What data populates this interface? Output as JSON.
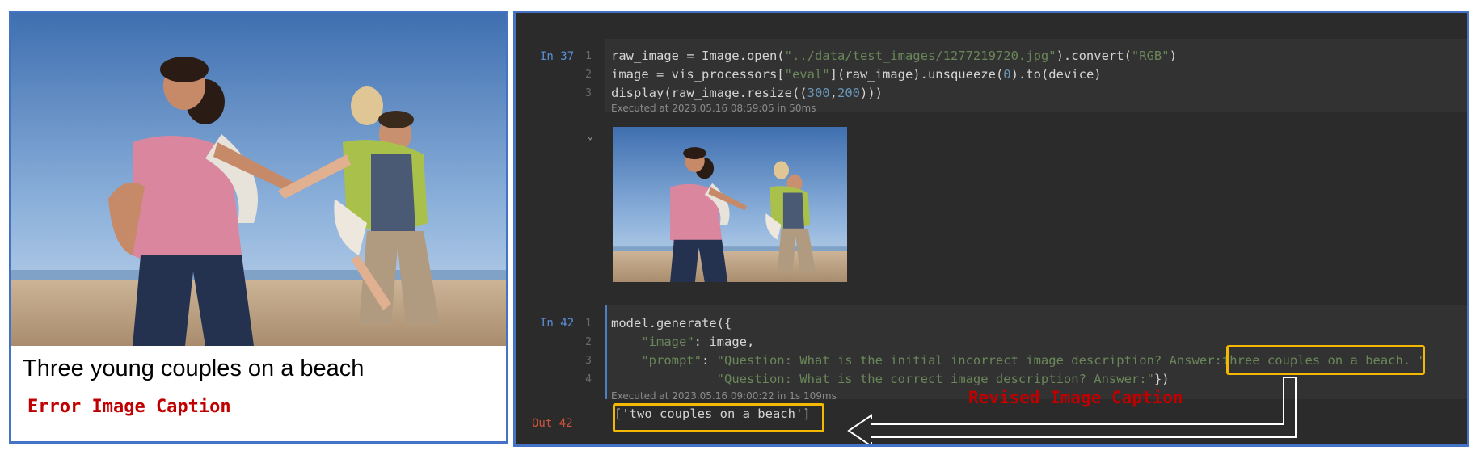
{
  "left": {
    "caption": "Three young couples on a beach",
    "error_label": "Error Image Caption"
  },
  "cells": [
    {
      "prompt": "In 37",
      "lines": [
        {
          "n": "1",
          "parts": [
            [
              "raw_image = Image.open(",
              ""
            ],
            [
              "\"../data/test_images/1277219720.jpg\"",
              "str"
            ],
            [
              ").convert(",
              ""
            ],
            [
              "\"RGB\"",
              "str"
            ],
            [
              ")",
              ""
            ]
          ]
        },
        {
          "n": "2",
          "parts": [
            [
              "image = vis_processors[",
              ""
            ],
            [
              "\"eval\"",
              "str"
            ],
            [
              "](raw_image).unsqueeze(",
              ""
            ],
            [
              "0",
              "num"
            ],
            [
              ").to(device)",
              ""
            ]
          ]
        },
        {
          "n": "3",
          "parts": [
            [
              "display(raw_image.resize((",
              ""
            ],
            [
              "300",
              "num"
            ],
            [
              ",",
              ""
            ],
            [
              "200",
              "num"
            ],
            [
              ")))",
              ""
            ]
          ]
        }
      ],
      "executed": "Executed at 2023.05.16 08:59:05 in 50ms"
    },
    {
      "prompt": "In 42",
      "lines": [
        {
          "n": "1",
          "parts": [
            [
              "model.generate({",
              ""
            ]
          ]
        },
        {
          "n": "2",
          "parts": [
            [
              "    ",
              ""
            ],
            [
              "\"image\"",
              "str"
            ],
            [
              ": image,",
              ""
            ]
          ]
        },
        {
          "n": "3",
          "parts": [
            [
              "    ",
              ""
            ],
            [
              "\"prompt\"",
              "str"
            ],
            [
              ": ",
              ""
            ],
            [
              "\"Question: What is the initial incorrect image description? Answer:three couples on a beach. \"",
              "str"
            ]
          ]
        },
        {
          "n": "4",
          "parts": [
            [
              "              ",
              ""
            ],
            [
              "\"Question: What is the correct image description? Answer:\"",
              "str"
            ],
            [
              "})",
              ""
            ]
          ]
        }
      ],
      "executed": "Executed at 2023.05.16 09:00:22 in 1s 109ms"
    }
  ],
  "output": {
    "prompt": "Out 42",
    "text": "['two couples on a beach']"
  },
  "annotation": {
    "revised_label": "Revised Image Caption"
  },
  "colors": {
    "highlight": "#f5b800",
    "annotation_red": "#c00000",
    "panel_border": "#4472c4"
  }
}
